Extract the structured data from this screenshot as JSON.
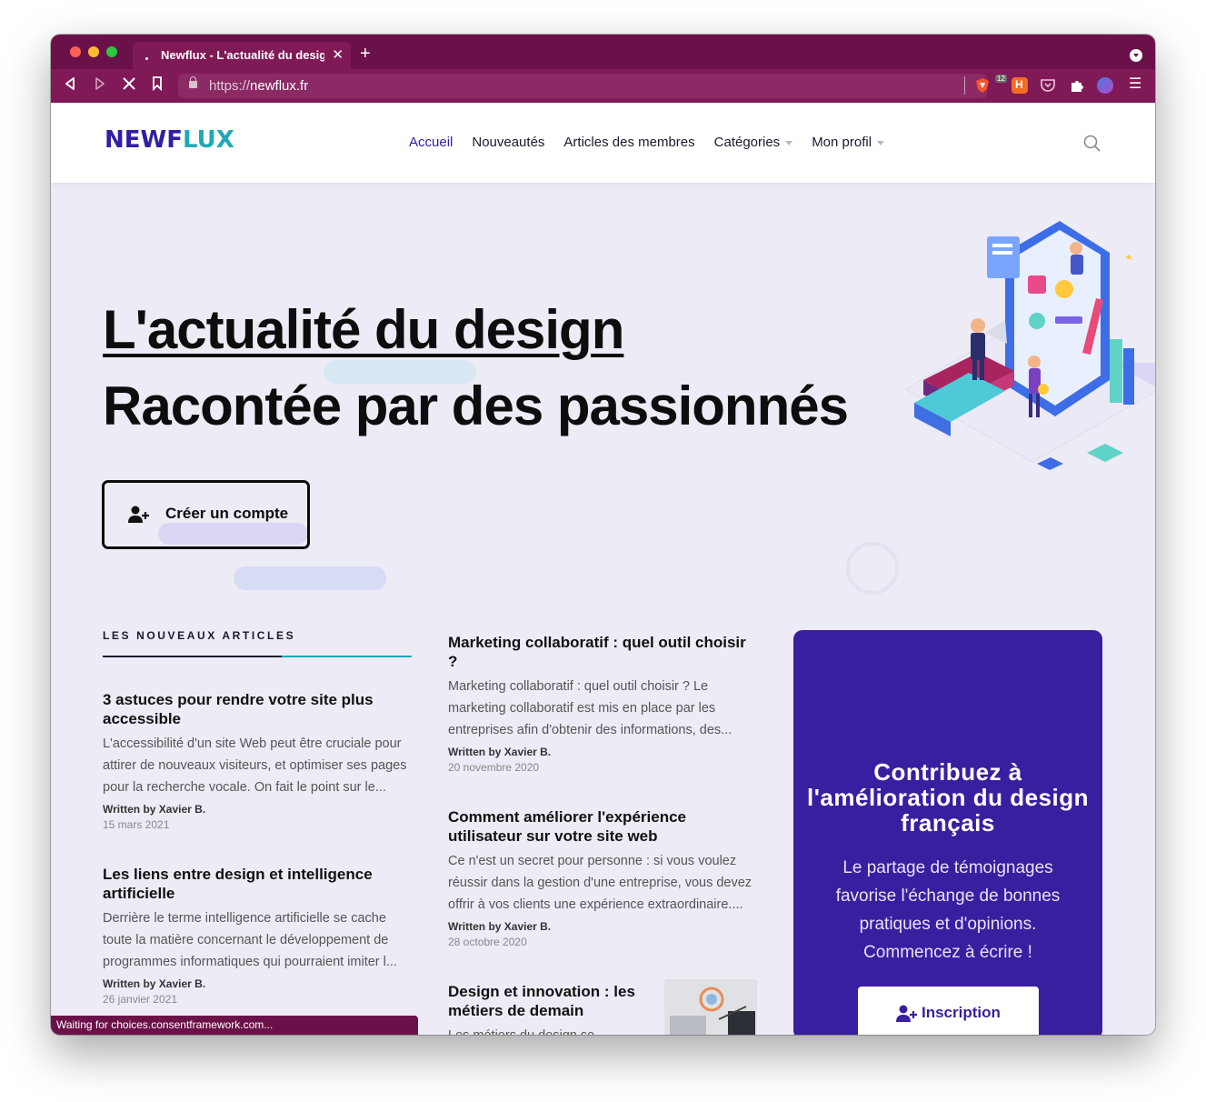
{
  "browser": {
    "tab_title": "Newflux - L'actualité du design",
    "url_protocol": "https://",
    "url_host": "newflux.fr",
    "shield_badge": "12",
    "status_text": "Waiting for choices.consentframework.com..."
  },
  "site": {
    "logo_part1": "NEWF",
    "logo_part2": "LUX",
    "nav": [
      {
        "label": "Accueil",
        "active": true
      },
      {
        "label": "Nouveautés"
      },
      {
        "label": "Articles des membres"
      },
      {
        "label": "Catégories",
        "dropdown": true
      },
      {
        "label": "Mon profil",
        "dropdown": true
      }
    ]
  },
  "hero": {
    "title_line1": "L'actualité du design",
    "title_line2": "Racontée par des passionnés",
    "cta_label": "Créer un compte"
  },
  "articles_section": {
    "label": "LES NOUVEAUX ARTICLES",
    "left_column": [
      {
        "title": "3 astuces pour rendre votre site plus accessible",
        "excerpt": "L'accessibilité d'un site Web peut être cruciale pour attirer de nouveaux visiteurs, et optimiser ses pages pour la recherche vocale. On fait le point sur le...",
        "author": "Written by Xavier B.",
        "date": "15 mars 2021"
      },
      {
        "title": "Les liens entre design et intelligence artificielle",
        "excerpt": "Derrière le terme intelligence artificielle se cache toute la matière concernant le développement de programmes informatiques qui pourraient imiter l...",
        "author": "Written by Xavier B.",
        "date": "26 janvier 2021"
      }
    ],
    "middle_column": [
      {
        "title": "Marketing collaboratif : quel outil choisir ?",
        "excerpt": "Marketing collaboratif : quel outil choisir ? Le marketing collaboratif est mis en place par les entreprises afin d'obtenir des informations, des...",
        "author": "Written by Xavier B.",
        "date": "20 novembre 2020"
      },
      {
        "title": "Comment améliorer l'expérience utilisateur sur votre site web",
        "excerpt": "Ce n'est un secret pour personne : si vous voulez réussir dans la gestion d'une entreprise, vous devez offrir à vos clients une expérience extraordinaire....",
        "author": "Written by Xavier B.",
        "date": "28 octobre 2020"
      },
      {
        "title": "Design et innovation : les métiers de demain",
        "excerpt": "Les métiers du design se"
      }
    ]
  },
  "panel": {
    "title": "Contribuez à l'amélioration du design français",
    "text": "Le partage de témoignages favorise l'échange de bonnes pratiques et d'opinions. Commencez à écrire !",
    "button_label": "Inscription"
  },
  "colors": {
    "browser_chrome": "#6b1149",
    "browser_toolbar": "#7f1a57",
    "brand_purple": "#3a1ea0",
    "brand_teal": "#20a8b5",
    "page_bg": "#edebf5"
  }
}
